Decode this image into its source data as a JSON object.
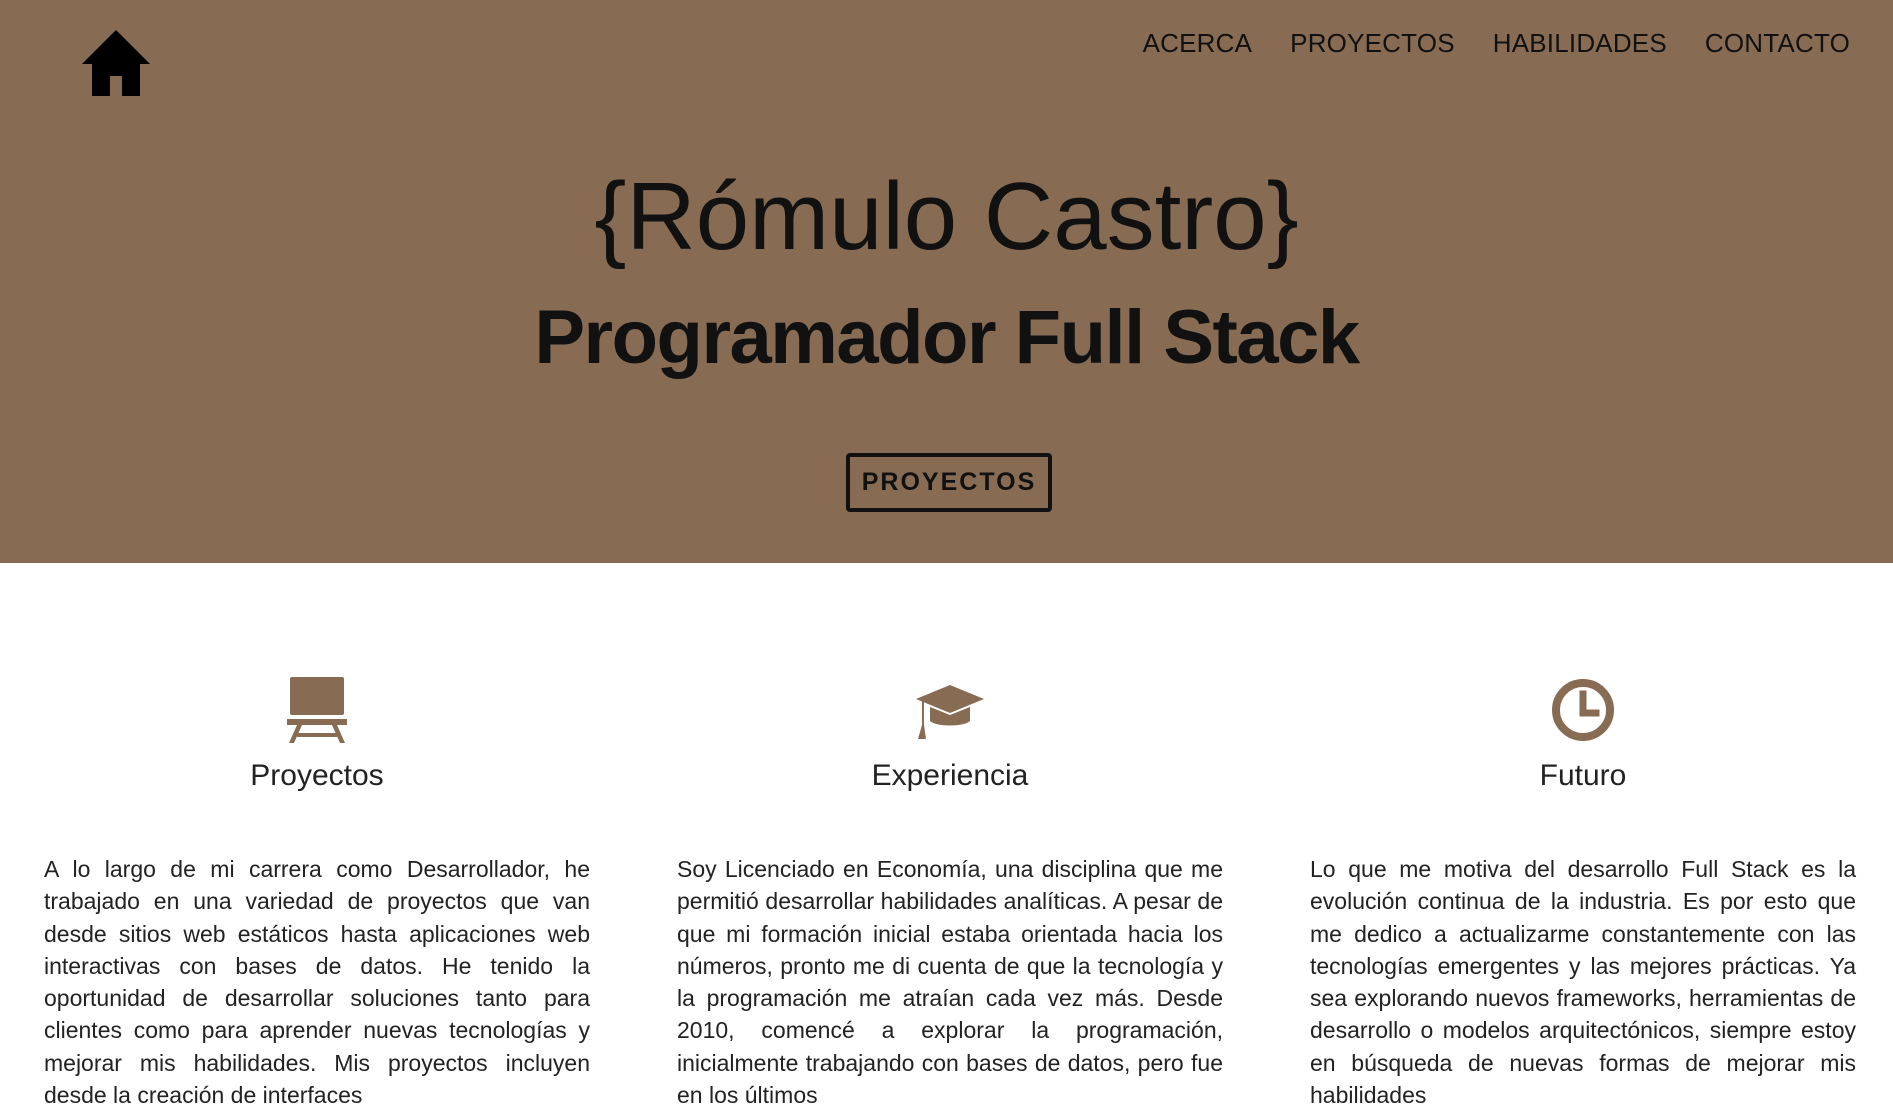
{
  "colors": {
    "hero_background": "#876c53",
    "accent": "#876c53",
    "text": "#111111"
  },
  "header": {
    "home_icon": "home-icon",
    "nav": [
      {
        "label": "ACERCA"
      },
      {
        "label": "PROYECTOS"
      },
      {
        "label": "HABILIDADES"
      },
      {
        "label": "CONTACTO"
      }
    ]
  },
  "hero": {
    "name": "{Rómulo Castro}",
    "role": "Programador Full Stack",
    "button_label": "PROYECTOS"
  },
  "features": [
    {
      "icon": "easel-icon",
      "title": "Proyectos",
      "text": "A lo largo de mi carrera como Desarrollador, he trabajado en una variedad de proyectos que van desde sitios web estáticos hasta aplicaciones web interactivas con bases de datos. He tenido la oportunidad de desarrollar soluciones tanto para clientes como para aprender nuevas tecnologías y mejorar mis habilidades. Mis proyectos incluyen desde la creación de interfaces"
    },
    {
      "icon": "graduation-cap-icon",
      "title": "Experiencia",
      "text": "Soy Licenciado en Economía, una disciplina que me permitió desarrollar habilidades analíticas. A pesar de que mi formación inicial estaba orientada hacia los números, pronto me di cuenta de que la tecnología y la programación me atraían cada vez más. Desde 2010, comencé a explorar la programación, inicialmente trabajando con bases de datos, pero fue en los últimos"
    },
    {
      "icon": "clock-icon",
      "title": "Futuro",
      "text": "Lo que me motiva del desarrollo Full Stack es la evolución continua de la industria. Es por esto que me dedico a actualizarme constantemente con las tecnologías emergentes y las mejores prácticas. Ya sea explorando nuevos frameworks, herramientas de desarrollo o modelos arquitectónicos, siempre estoy en búsqueda de nuevas formas de mejorar mis habilidades"
    }
  ]
}
